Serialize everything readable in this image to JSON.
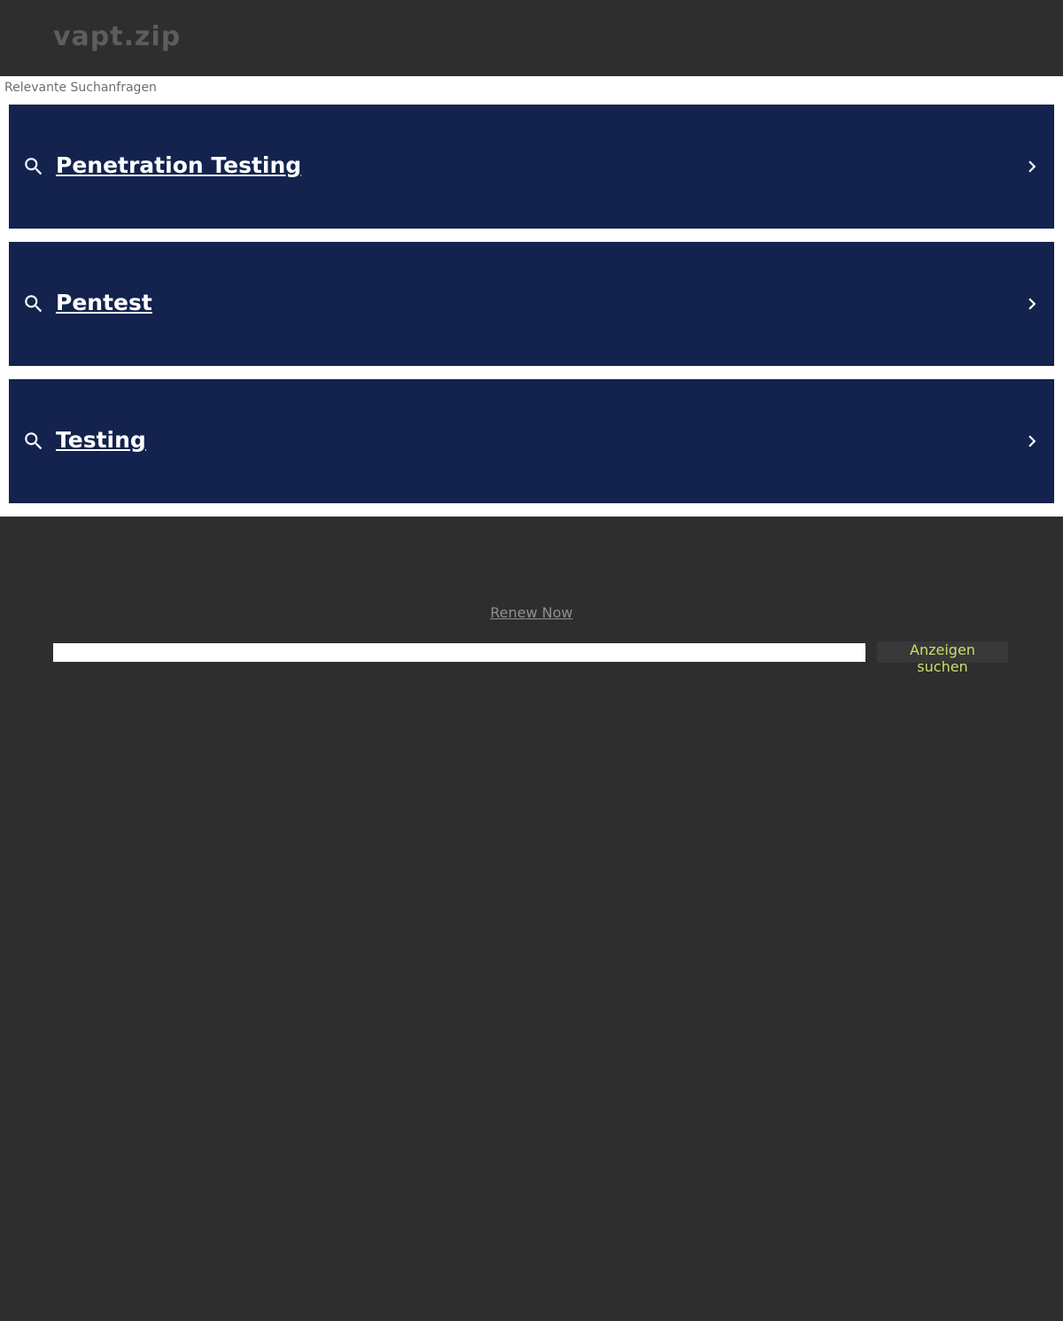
{
  "header": {
    "domain": "vapt.zip"
  },
  "related": {
    "heading": "Relevante Suchanfragen",
    "items": [
      {
        "label": "Penetration Testing"
      },
      {
        "label": "Pentest"
      },
      {
        "label": "Testing"
      }
    ]
  },
  "footer": {
    "renew_label": "Renew Now",
    "search_placeholder": "",
    "search_button_label": "Anzeigen suchen"
  },
  "colors": {
    "background": "#2e2e2e",
    "result_background": "#13234e",
    "result_text": "#ffffff",
    "button_text": "#c6e169"
  },
  "icons": {
    "result_leading": "search-icon",
    "result_trailing": "chevron-right-icon"
  }
}
